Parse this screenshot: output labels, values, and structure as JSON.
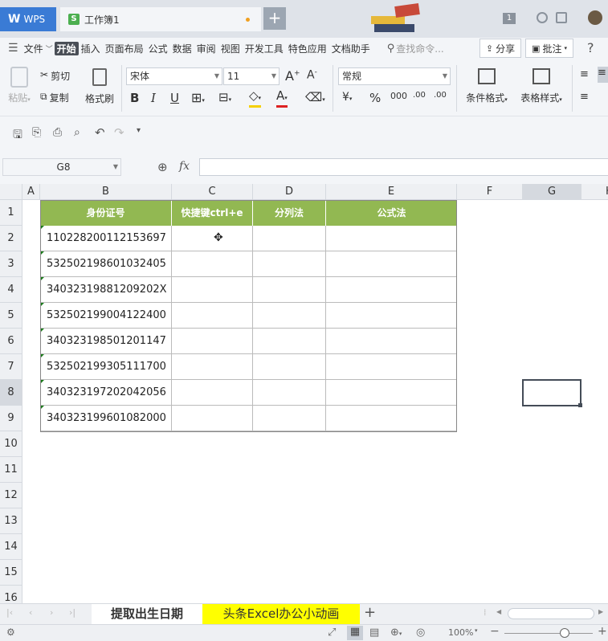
{
  "titlebar": {
    "wps_label": "WPS",
    "doc_title": "工作簿1",
    "badge_number": "1"
  },
  "menu": {
    "file_label": "文件",
    "items": [
      "开始",
      "插入",
      "页面布局",
      "公式",
      "数据",
      "审阅",
      "视图",
      "开发工具",
      "特色应用",
      "文档助手"
    ],
    "search_placeholder": "查找命令...",
    "share_label": "分享",
    "comment_label": "批注"
  },
  "ribbon": {
    "paste_label": "粘贴",
    "cut_label": "剪切",
    "copy_label": "复制",
    "format_painter_label": "格式刷",
    "font_name": "宋体",
    "font_size": "11",
    "number_format": "常规",
    "cond_format_label": "条件格式",
    "table_style_label": "表格样式"
  },
  "formula_bar": {
    "name_box": "G8",
    "fx_label": "fx",
    "formula": ""
  },
  "grid": {
    "columns": [
      "A",
      "B",
      "C",
      "D",
      "E",
      "F",
      "G",
      "H"
    ],
    "rows": [
      "1",
      "2",
      "3",
      "4",
      "5",
      "6",
      "7",
      "8",
      "9",
      "10",
      "11",
      "12",
      "13",
      "14",
      "15",
      "16"
    ],
    "headers": [
      "身份证号",
      "快捷键ctrl+e",
      "分列法",
      "公式法"
    ],
    "ids": [
      "110228200112153697",
      "532502198601032405",
      "34032319881209202X",
      "532502199004122400",
      "340323198501201147",
      "532502199305111700",
      "340323197202042056",
      "340323199601082000"
    ],
    "header_color": "#92b852",
    "selected_cell": "G8"
  },
  "sheets": {
    "tabs": [
      "提取出生日期",
      "头条Excel办公小动画"
    ],
    "active_tab_color": "#ffff00"
  },
  "status": {
    "zoom": "100%"
  }
}
